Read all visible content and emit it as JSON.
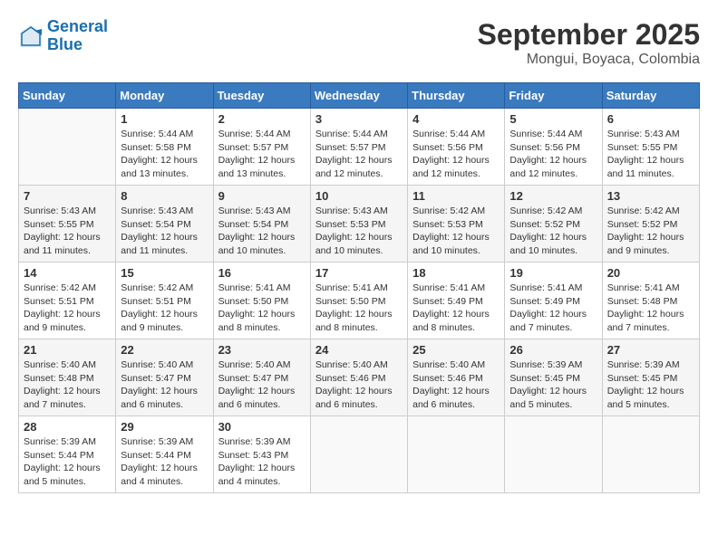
{
  "header": {
    "logo_line1": "General",
    "logo_line2": "Blue",
    "month": "September 2025",
    "location": "Mongui, Boyaca, Colombia"
  },
  "weekdays": [
    "Sunday",
    "Monday",
    "Tuesday",
    "Wednesday",
    "Thursday",
    "Friday",
    "Saturday"
  ],
  "weeks": [
    [
      {
        "day": "",
        "sunrise": "",
        "sunset": "",
        "daylight": ""
      },
      {
        "day": "1",
        "sunrise": "Sunrise: 5:44 AM",
        "sunset": "Sunset: 5:58 PM",
        "daylight": "Daylight: 12 hours and 13 minutes."
      },
      {
        "day": "2",
        "sunrise": "Sunrise: 5:44 AM",
        "sunset": "Sunset: 5:57 PM",
        "daylight": "Daylight: 12 hours and 13 minutes."
      },
      {
        "day": "3",
        "sunrise": "Sunrise: 5:44 AM",
        "sunset": "Sunset: 5:57 PM",
        "daylight": "Daylight: 12 hours and 12 minutes."
      },
      {
        "day": "4",
        "sunrise": "Sunrise: 5:44 AM",
        "sunset": "Sunset: 5:56 PM",
        "daylight": "Daylight: 12 hours and 12 minutes."
      },
      {
        "day": "5",
        "sunrise": "Sunrise: 5:44 AM",
        "sunset": "Sunset: 5:56 PM",
        "daylight": "Daylight: 12 hours and 12 minutes."
      },
      {
        "day": "6",
        "sunrise": "Sunrise: 5:43 AM",
        "sunset": "Sunset: 5:55 PM",
        "daylight": "Daylight: 12 hours and 11 minutes."
      }
    ],
    [
      {
        "day": "7",
        "sunrise": "Sunrise: 5:43 AM",
        "sunset": "Sunset: 5:55 PM",
        "daylight": "Daylight: 12 hours and 11 minutes."
      },
      {
        "day": "8",
        "sunrise": "Sunrise: 5:43 AM",
        "sunset": "Sunset: 5:54 PM",
        "daylight": "Daylight: 12 hours and 11 minutes."
      },
      {
        "day": "9",
        "sunrise": "Sunrise: 5:43 AM",
        "sunset": "Sunset: 5:54 PM",
        "daylight": "Daylight: 12 hours and 10 minutes."
      },
      {
        "day": "10",
        "sunrise": "Sunrise: 5:43 AM",
        "sunset": "Sunset: 5:53 PM",
        "daylight": "Daylight: 12 hours and 10 minutes."
      },
      {
        "day": "11",
        "sunrise": "Sunrise: 5:42 AM",
        "sunset": "Sunset: 5:53 PM",
        "daylight": "Daylight: 12 hours and 10 minutes."
      },
      {
        "day": "12",
        "sunrise": "Sunrise: 5:42 AM",
        "sunset": "Sunset: 5:52 PM",
        "daylight": "Daylight: 12 hours and 10 minutes."
      },
      {
        "day": "13",
        "sunrise": "Sunrise: 5:42 AM",
        "sunset": "Sunset: 5:52 PM",
        "daylight": "Daylight: 12 hours and 9 minutes."
      }
    ],
    [
      {
        "day": "14",
        "sunrise": "Sunrise: 5:42 AM",
        "sunset": "Sunset: 5:51 PM",
        "daylight": "Daylight: 12 hours and 9 minutes."
      },
      {
        "day": "15",
        "sunrise": "Sunrise: 5:42 AM",
        "sunset": "Sunset: 5:51 PM",
        "daylight": "Daylight: 12 hours and 9 minutes."
      },
      {
        "day": "16",
        "sunrise": "Sunrise: 5:41 AM",
        "sunset": "Sunset: 5:50 PM",
        "daylight": "Daylight: 12 hours and 8 minutes."
      },
      {
        "day": "17",
        "sunrise": "Sunrise: 5:41 AM",
        "sunset": "Sunset: 5:50 PM",
        "daylight": "Daylight: 12 hours and 8 minutes."
      },
      {
        "day": "18",
        "sunrise": "Sunrise: 5:41 AM",
        "sunset": "Sunset: 5:49 PM",
        "daylight": "Daylight: 12 hours and 8 minutes."
      },
      {
        "day": "19",
        "sunrise": "Sunrise: 5:41 AM",
        "sunset": "Sunset: 5:49 PM",
        "daylight": "Daylight: 12 hours and 7 minutes."
      },
      {
        "day": "20",
        "sunrise": "Sunrise: 5:41 AM",
        "sunset": "Sunset: 5:48 PM",
        "daylight": "Daylight: 12 hours and 7 minutes."
      }
    ],
    [
      {
        "day": "21",
        "sunrise": "Sunrise: 5:40 AM",
        "sunset": "Sunset: 5:48 PM",
        "daylight": "Daylight: 12 hours and 7 minutes."
      },
      {
        "day": "22",
        "sunrise": "Sunrise: 5:40 AM",
        "sunset": "Sunset: 5:47 PM",
        "daylight": "Daylight: 12 hours and 6 minutes."
      },
      {
        "day": "23",
        "sunrise": "Sunrise: 5:40 AM",
        "sunset": "Sunset: 5:47 PM",
        "daylight": "Daylight: 12 hours and 6 minutes."
      },
      {
        "day": "24",
        "sunrise": "Sunrise: 5:40 AM",
        "sunset": "Sunset: 5:46 PM",
        "daylight": "Daylight: 12 hours and 6 minutes."
      },
      {
        "day": "25",
        "sunrise": "Sunrise: 5:40 AM",
        "sunset": "Sunset: 5:46 PM",
        "daylight": "Daylight: 12 hours and 6 minutes."
      },
      {
        "day": "26",
        "sunrise": "Sunrise: 5:39 AM",
        "sunset": "Sunset: 5:45 PM",
        "daylight": "Daylight: 12 hours and 5 minutes."
      },
      {
        "day": "27",
        "sunrise": "Sunrise: 5:39 AM",
        "sunset": "Sunset: 5:45 PM",
        "daylight": "Daylight: 12 hours and 5 minutes."
      }
    ],
    [
      {
        "day": "28",
        "sunrise": "Sunrise: 5:39 AM",
        "sunset": "Sunset: 5:44 PM",
        "daylight": "Daylight: 12 hours and 5 minutes."
      },
      {
        "day": "29",
        "sunrise": "Sunrise: 5:39 AM",
        "sunset": "Sunset: 5:44 PM",
        "daylight": "Daylight: 12 hours and 4 minutes."
      },
      {
        "day": "30",
        "sunrise": "Sunrise: 5:39 AM",
        "sunset": "Sunset: 5:43 PM",
        "daylight": "Daylight: 12 hours and 4 minutes."
      },
      {
        "day": "",
        "sunrise": "",
        "sunset": "",
        "daylight": ""
      },
      {
        "day": "",
        "sunrise": "",
        "sunset": "",
        "daylight": ""
      },
      {
        "day": "",
        "sunrise": "",
        "sunset": "",
        "daylight": ""
      },
      {
        "day": "",
        "sunrise": "",
        "sunset": "",
        "daylight": ""
      }
    ]
  ]
}
